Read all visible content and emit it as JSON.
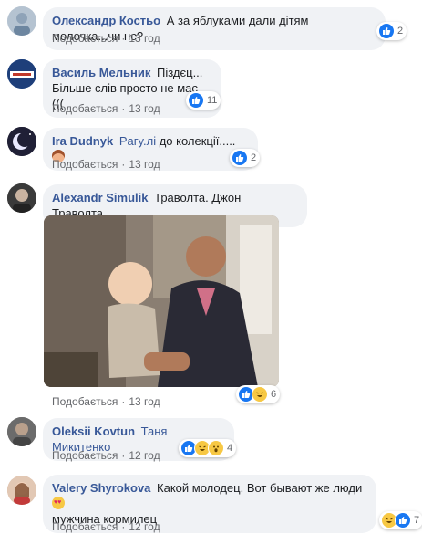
{
  "comments": [
    {
      "author": "Олександр Костьо",
      "text": "А за яблуками дали дітям молочка...чи нє?",
      "like_label": "Подобається",
      "time": "13 год",
      "reaction_count": "2",
      "reactions": [
        "like-icon"
      ]
    },
    {
      "author": "Василь Мельник",
      "text_line1": "Піздєц...",
      "text_line2": "Більше слів просто не має (((",
      "like_label": "Подобається",
      "time": "13 год",
      "reaction_count": "11",
      "reactions": [
        "like-icon"
      ]
    },
    {
      "author": "Ira Dudnyk",
      "mention": "Paгy.лі",
      "text": "до колекції.....",
      "like_label": "Подобається",
      "time": "13 год",
      "reaction_count": "2",
      "reactions": [
        "like-icon"
      ]
    },
    {
      "author": "Alexandr Simulik",
      "text": "Траволта. Джон Траволта.",
      "like_label": "Подобається",
      "time": "13 год",
      "reaction_count": "6",
      "reactions": [
        "like-icon",
        "haha-icon"
      ]
    },
    {
      "author": "Oleksii Kovtun",
      "mention": "Таня Микитенко",
      "like_label": "Подобається",
      "time": "12 год",
      "reaction_count": "4",
      "reactions": [
        "like-icon",
        "haha-icon",
        "wow-icon"
      ]
    },
    {
      "author": "Valery Shyrokova",
      "text_line1": "Какой молодец. Вот бывают же люди",
      "text_line2": "мужчина кормилец",
      "like_label": "Подобається",
      "time": "12 год",
      "reaction_count": "7",
      "reactions": [
        "haha-icon",
        "like-icon"
      ]
    }
  ],
  "colors": {
    "author": "#385898",
    "bubble": "#f0f2f5",
    "like": "#1877f2",
    "meta": "#65676b"
  }
}
